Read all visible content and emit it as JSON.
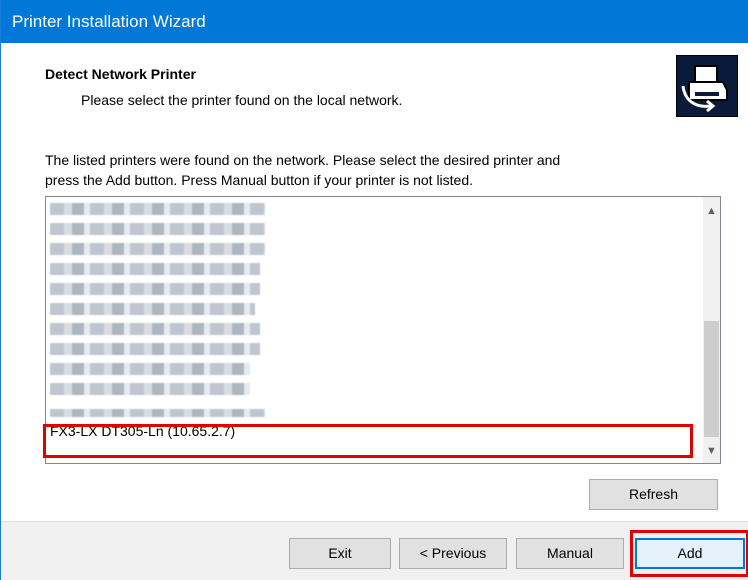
{
  "window": {
    "title": "Printer Installation Wizard"
  },
  "header": {
    "title": "Detect Network Printer",
    "subtitle": "Please select the printer found on the local network.",
    "icon": "printer-wizard-icon"
  },
  "description": {
    "line1": "The listed printers were found on the network. Please select the desired printer and",
    "line2": "press the Add button. Press Manual button if your printer is not listed."
  },
  "printer_list": {
    "visible_item": "FX3-LX DT305-Ln (10.65.2.7)",
    "blurred_count_visible": 11
  },
  "buttons": {
    "refresh": "Refresh",
    "exit": "Exit",
    "previous": "< Previous",
    "manual": "Manual",
    "add": "Add"
  },
  "colors": {
    "titlebar": "#0078d7",
    "highlight": "#e00000"
  }
}
